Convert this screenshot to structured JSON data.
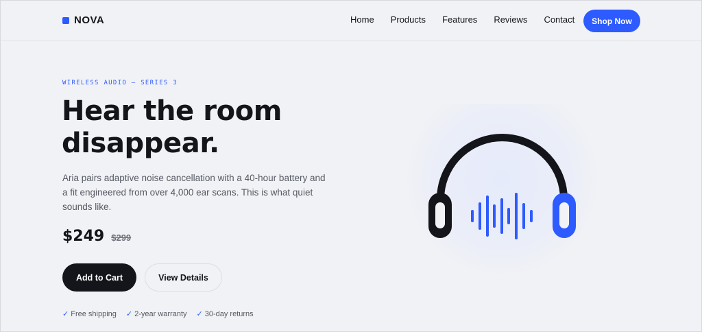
{
  "brand": {
    "name": "NOVA",
    "accent": "#2d5bff"
  },
  "nav": {
    "items": [
      "Home",
      "Products",
      "Features",
      "Reviews",
      "Contact"
    ],
    "cta": "Shop Now"
  },
  "hero": {
    "eyebrow": "WIRELESS AUDIO — SERIES 3",
    "headline_line1": "Hear the room",
    "headline_line2": "disappear.",
    "description": "Aria pairs adaptive noise cancellation with a 40-hour battery and a fit engineered from over 4,000 ear scans. This is what quiet sounds like.",
    "price": "$249",
    "old_price": "$299",
    "primary_button": "Add to Cart",
    "secondary_button": "View Details",
    "features": [
      "Free shipping",
      "2-year warranty",
      "30-day returns"
    ],
    "check_glyph": "✓"
  },
  "illustration": {
    "icon": "headphones-icon",
    "colors": {
      "band": "#14151a",
      "accent": "#2d5bff"
    }
  }
}
